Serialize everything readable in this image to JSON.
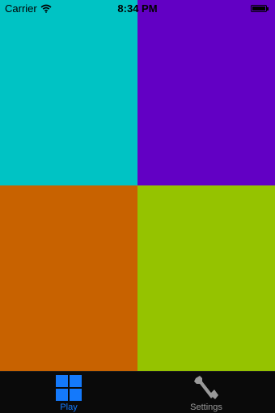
{
  "status_bar": {
    "carrier": "Carrier",
    "time": "8:34 PM",
    "icons": [
      "wifi-icon",
      "battery-icon"
    ]
  },
  "tiles": [
    {
      "name": "top-left",
      "color": "#00c3c4"
    },
    {
      "name": "top-right",
      "color": "#6200c4"
    },
    {
      "name": "bottom-left",
      "color": "#c86200"
    },
    {
      "name": "bottom-right",
      "color": "#95c300"
    }
  ],
  "tab_bar": {
    "tabs": [
      {
        "label": "Play",
        "icon": "grid-icon",
        "active": true,
        "color": "#1479fb"
      },
      {
        "label": "Settings",
        "icon": "wrench-icon",
        "active": false,
        "color": "#9a9a9a"
      }
    ]
  }
}
